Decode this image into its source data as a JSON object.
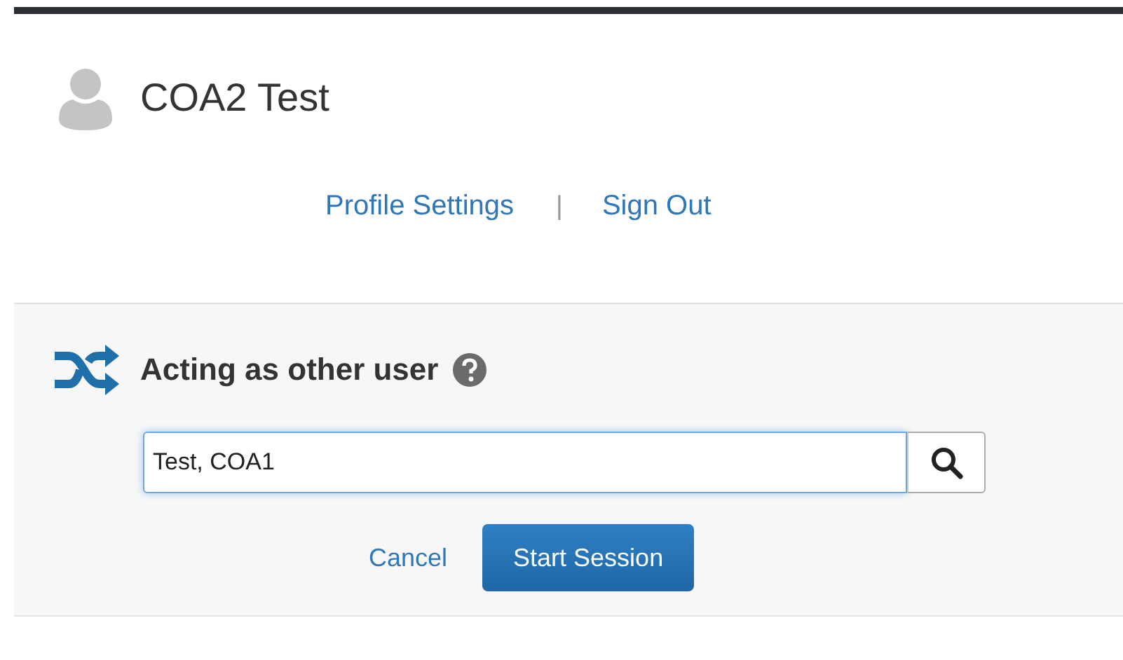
{
  "user": {
    "name": "COA2 Test"
  },
  "links": [
    "Profile Settings",
    "Sign Out"
  ],
  "separator": "|",
  "proxy": {
    "title": "Acting as other user",
    "search": {
      "value": "Test, COA1"
    },
    "cancel": "Cancel",
    "start": "Start Session"
  }
}
